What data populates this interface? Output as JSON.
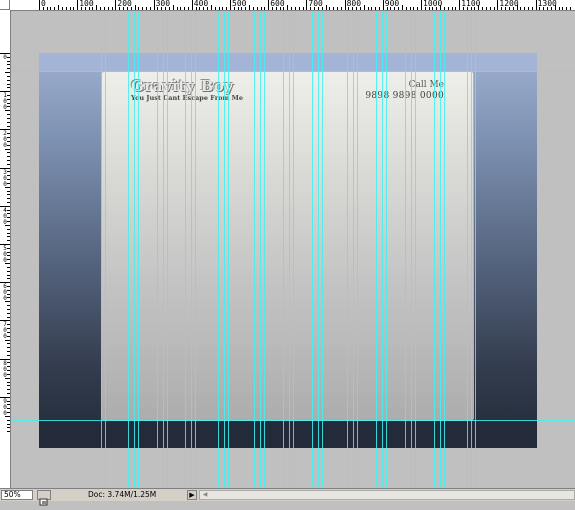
{
  "ruler": {
    "top_labels": [
      "0",
      "100",
      "200",
      "300",
      "400",
      "500",
      "600",
      "700",
      "800",
      "900",
      "1000",
      "1100",
      "1200",
      "1300"
    ],
    "left_labels": [
      "0",
      "100",
      "200",
      "300",
      "400",
      "500",
      "600",
      "700",
      "800",
      "900"
    ]
  },
  "document": {
    "brand_title": "Gravity Boy",
    "brand_tagline": "You Just Cant Escape From Me",
    "call_label": "Call Me",
    "call_number": "9898 9898 0000"
  },
  "status_bar": {
    "zoom": "50%",
    "doc_info": "Doc: 3.74M/1.25M",
    "arrow_glyph": "▶",
    "scroll_left_glyph": "◀"
  },
  "icons": {
    "status_nav": "document-navigator-icon",
    "status_menu": "status-menu-arrow-icon",
    "scroll_left": "scroll-left-arrow-icon"
  },
  "colors": {
    "guide": "#3df2f2",
    "doc_gradient_top": "#9eb0d0",
    "doc_gradient_bottom": "#222a38"
  }
}
